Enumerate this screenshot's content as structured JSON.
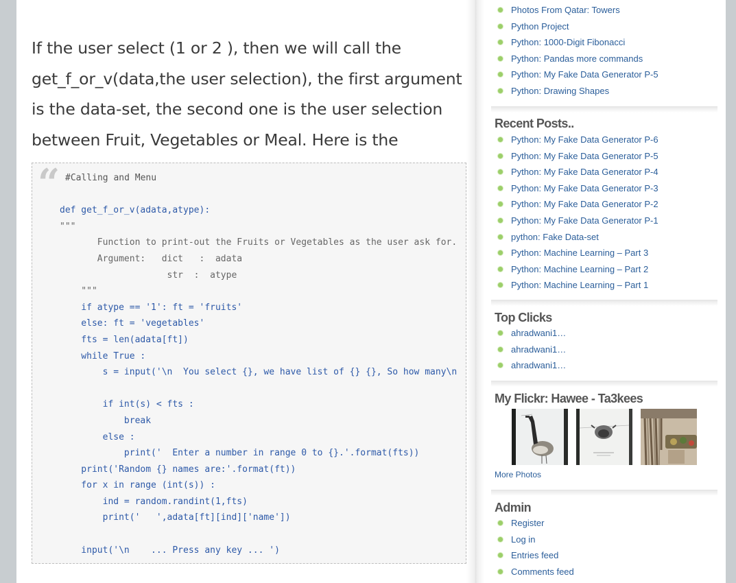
{
  "article": {
    "intro": "If the user select (1 or 2 ), then we will call the get_f_or_v(data,the user selection), the first argument is the data-set, the second one is the user selection between Fruit, Vegetables or Meal. Here is the function .."
  },
  "code": {
    "lines": [
      {
        "text": "#Calling and Menu",
        "cls": "comment"
      },
      {
        "text": "",
        "cls": ""
      },
      {
        "text": "def get_f_or_v(adata,atype):",
        "cls": ""
      },
      {
        "text": "\"\"\"",
        "cls": "doc"
      },
      {
        "text": "       Function to print-out the Fruits or Vegetables as the user ask for.",
        "cls": "doc"
      },
      {
        "text": "       Argument:   dict   :  adata",
        "cls": "doc"
      },
      {
        "text": "                    str  :  atype",
        "cls": "doc"
      },
      {
        "text": "    \"\"\"",
        "cls": "doc"
      },
      {
        "text": "    if atype == '1': ft = 'fruits'",
        "cls": ""
      },
      {
        "text": "    else: ft = 'vegetables'",
        "cls": ""
      },
      {
        "text": "    fts = len(adata[ft])",
        "cls": ""
      },
      {
        "text": "    while True :",
        "cls": ""
      },
      {
        "text": "        s = input('\\n  You select {}, we have list of {} {}, So how many\\n",
        "cls": ""
      },
      {
        "text": "",
        "cls": ""
      },
      {
        "text": "        if int(s) < fts :",
        "cls": ""
      },
      {
        "text": "            break",
        "cls": ""
      },
      {
        "text": "        else :",
        "cls": ""
      },
      {
        "text": "            print('  Enter a number in range 0 to {}.'.format(fts))",
        "cls": ""
      },
      {
        "text": "    print('Random {} names are:'.format(ft))",
        "cls": ""
      },
      {
        "text": "    for x in range (int(s)) :",
        "cls": ""
      },
      {
        "text": "        ind = random.randint(1,fts)",
        "cls": ""
      },
      {
        "text": "        print('   ',adata[ft][ind]['name'])",
        "cls": ""
      },
      {
        "text": "",
        "cls": ""
      },
      {
        "text": "    input('\\n    ... Press any key ... ')",
        "cls": ""
      }
    ]
  },
  "sidebar": {
    "top_links": [
      "Photos From Qatar: Towers",
      "Python Project",
      "Python: 1000-Digit Fibonacci",
      "Python: Pandas more commands",
      "Python: My Fake Data Generator P-5",
      "Python: Drawing Shapes"
    ],
    "recent": {
      "title": "Recent Posts..",
      "items": [
        "Python: My Fake Data Generator P-6",
        "Python: My Fake Data Generator P-5",
        "Python: My Fake Data Generator P-4",
        "Python: My Fake Data Generator P-3",
        "Python: My Fake Data Generator P-2",
        "Python: My Fake Data Generator P-1",
        "python: Fake Data-set",
        "Python: Machine Learning – Part 3",
        "Python: Machine Learning – Part 2",
        "Python: Machine Learning – Part 1"
      ]
    },
    "clicks": {
      "title": "Top Clicks",
      "items": [
        "ahradwani1…",
        "ahradwani1…",
        "ahradwani1…"
      ]
    },
    "flickr": {
      "title": "My Flickr: Hawee - Ta3kees",
      "more": "More Photos"
    },
    "admin": {
      "title": "Admin",
      "items": [
        "Register",
        "Log in",
        "Entries feed",
        "Comments feed"
      ]
    }
  },
  "colors": {
    "link": "#2b5e9a",
    "code": "#2d59a8",
    "bullet": "#9ccf6a"
  }
}
